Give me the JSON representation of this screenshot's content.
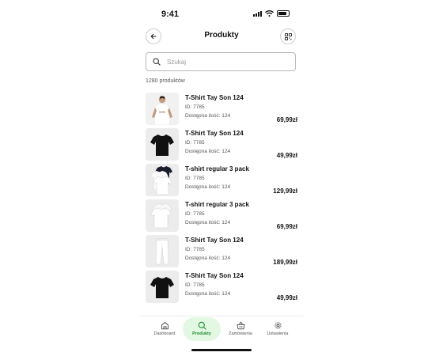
{
  "status_bar": {
    "time": "9:41"
  },
  "header": {
    "title": "Produkty"
  },
  "search": {
    "placeholder": "Szukaj"
  },
  "products_count": "1280 produktów",
  "products": [
    {
      "name": "T-Shirt Tay Son 124",
      "id": "ID: 7785",
      "stock": "Dostępna ilość: 124",
      "price": "69,99zł",
      "image": "model-white-tshirt"
    },
    {
      "name": "T-Shirt Tay Son 124",
      "id": "ID: 7785",
      "stock": "Dostępna ilość: 124",
      "price": "49,99zł",
      "image": "black-tshirt"
    },
    {
      "name": "T-shirt regular 3 pack",
      "id": "ID: 7785",
      "stock": "Dostępna ilość: 124",
      "price": "129,99zł",
      "image": "tshirt-3-pack"
    },
    {
      "name": "T-shirt regular 3 pack",
      "id": "ID: 7785",
      "stock": "Dostępna ilość: 124",
      "price": "69,99zł",
      "image": "white-tshirts-stack"
    },
    {
      "name": "T-Shirt Tay Son 124",
      "id": "ID: 7785",
      "stock": "Dostępna ilość: 124",
      "price": "189,99zł",
      "image": "white-pants"
    },
    {
      "name": "T-Shirt Tay Son 124",
      "id": "ID: 7785",
      "stock": "Dostępna ilość: 124",
      "price": "49,99zł",
      "image": "black-tshirt"
    }
  ],
  "tabbar": {
    "items": [
      {
        "label": "Dashboard",
        "icon": "home-icon",
        "active": false
      },
      {
        "label": "Produkty",
        "icon": "search-icon",
        "active": true
      },
      {
        "label": "Zamówienia",
        "icon": "basket-icon",
        "active": false
      },
      {
        "label": "Ustawienia",
        "icon": "gear-icon",
        "active": false
      }
    ]
  },
  "colors": {
    "accent": "#1a8f2e",
    "accent_bg": "#e3f8e3",
    "border": "#b8b8b8"
  }
}
